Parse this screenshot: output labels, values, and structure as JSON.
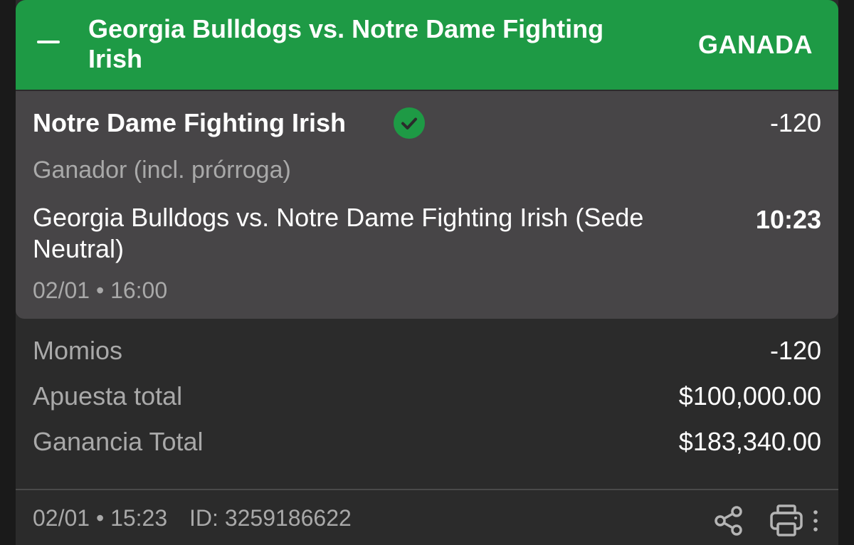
{
  "header": {
    "title": "Georgia Bulldogs vs. Notre Dame Fighting Irish",
    "status": "GANADA",
    "accent_color": "#1e9a45"
  },
  "selection": {
    "team": "Notre Dame Fighting Irish",
    "status_icon": "check-circle-icon",
    "odds": "-120",
    "market": "Ganador (incl. prórroga)",
    "event": "Georgia Bulldogs vs. Notre Dame Fighting Irish (Sede Neutral)",
    "score": "10:23",
    "date": "02/01 • 16:00"
  },
  "summary": [
    {
      "label": "Momios",
      "value": "-120"
    },
    {
      "label": "Apuesta total",
      "value": "$100,000.00"
    },
    {
      "label": "Ganancia Total",
      "value": "$183,340.00"
    }
  ],
  "footer": {
    "datetime": "02/01 • 15:23",
    "id": "ID: 3259186622",
    "icons": [
      "share-icon",
      "print-icon",
      "more-vertical-icon"
    ]
  }
}
